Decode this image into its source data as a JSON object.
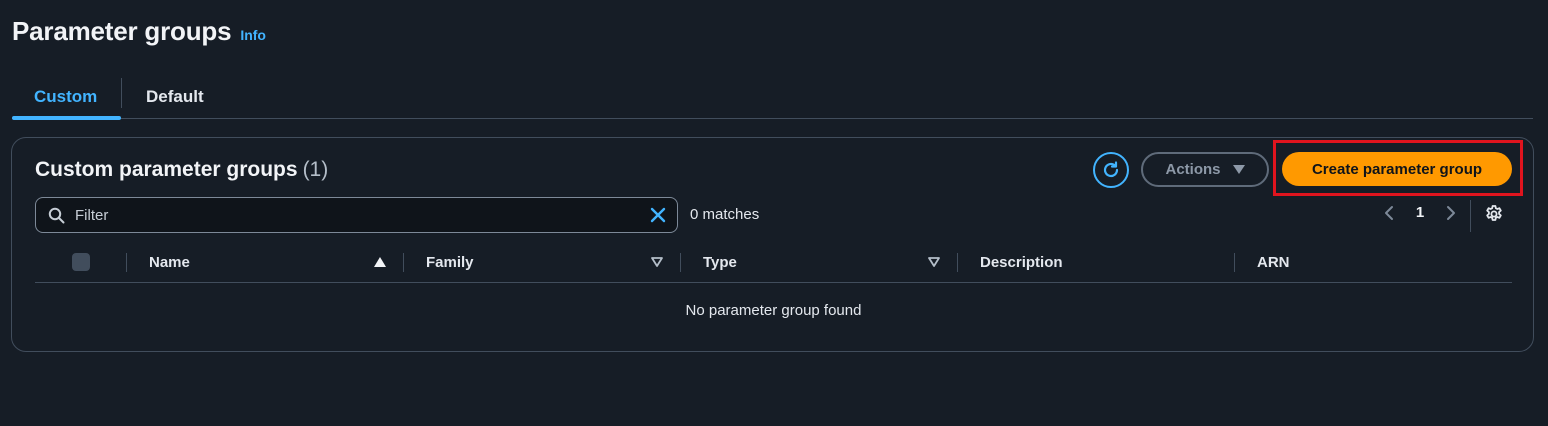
{
  "header": {
    "title": "Parameter groups",
    "info_link": "Info"
  },
  "tabs": [
    {
      "label": "Custom",
      "selected": true
    },
    {
      "label": "Default",
      "selected": false
    }
  ],
  "panel": {
    "title": "Custom parameter groups",
    "count": "(1)",
    "actions_label": "Actions",
    "create_label": "Create parameter group",
    "icons": {
      "refresh": "refresh-icon",
      "dropdown": "caret-down-icon",
      "settings": "gear-icon"
    }
  },
  "filter": {
    "placeholder": "Filter",
    "value": "",
    "matches": "0 matches"
  },
  "pagination": {
    "current_page": "1"
  },
  "table": {
    "columns": [
      "Name",
      "Family",
      "Type",
      "Description",
      "ARN"
    ],
    "sort": {
      "column": "Name",
      "direction": "ascending"
    },
    "empty_message": "No parameter group found"
  },
  "colors": {
    "background": "#161d26",
    "accent": "#42b4ff",
    "primary_button": "#ff9900",
    "highlight": "#e0141e",
    "border": "#414d5c"
  }
}
